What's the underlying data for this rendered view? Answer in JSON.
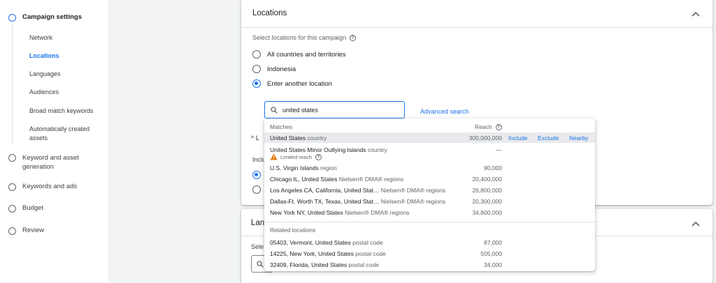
{
  "sidebar": {
    "steps": [
      {
        "label": "Campaign settings"
      },
      {
        "label": "Keyword and asset generation"
      },
      {
        "label": "Keywords and ads"
      },
      {
        "label": "Budget"
      },
      {
        "label": "Review"
      }
    ],
    "subitems": [
      "Network",
      "Locations",
      "Languages",
      "Audiences",
      "Broad match keywords",
      "Automatically created assets"
    ]
  },
  "locations_card": {
    "title": "Locations",
    "prompt": "Select locations for this campaign",
    "options": [
      "All countries and territories",
      "Indonesia",
      "Enter another location"
    ],
    "selected_option": "Enter another location",
    "search_value": "united states",
    "advanced_search": "Advanced search",
    "partial_text": [
      "^ L",
      "Inclu"
    ]
  },
  "languages_card": {
    "title_partial": "Lan",
    "prompt_partial": "Sele"
  },
  "dropdown": {
    "matches_header": "Matches",
    "reach_header": "Reach",
    "actions": {
      "include": "Include",
      "exclude": "Exclude",
      "nearby": "Nearby"
    },
    "matches": [
      {
        "name": "United States",
        "type": "country",
        "reach": "300,000,000"
      },
      {
        "name": "United States Minor Outlying Islands",
        "type": "country",
        "reach": "—"
      },
      {
        "name": "U.S. Virgin Islands",
        "type": "region",
        "reach": "90,000"
      },
      {
        "name": "Chicago IL, United States",
        "type": "Nielsen® DMA® regions",
        "reach": "20,400,000"
      },
      {
        "name": "Los Angeles CA, California, United Stat…",
        "type": "Nielsen® DMA® regions",
        "reach": "26,800,000"
      },
      {
        "name": "Dallas-Ft. Worth TX, Texas, United Stat…",
        "type": "Nielsen® DMA® regions",
        "reach": "20,300,000"
      },
      {
        "name": "New York NY, United States",
        "type": "Nielsen® DMA® regions",
        "reach": "34,800,000"
      }
    ],
    "limited_reach": "Limited reach",
    "related_header": "Related locations",
    "related": [
      {
        "name": "05403, Vermont, United States",
        "type": "postal code",
        "reach": "87,000"
      },
      {
        "name": "14225, New York, United States",
        "type": "postal code",
        "reach": "505,000"
      },
      {
        "name": "32409, Florida, United States",
        "type": "postal code",
        "reach": "34,000"
      }
    ]
  },
  "colors": {
    "accent": "#1a73e8",
    "warning": "#e37400"
  }
}
